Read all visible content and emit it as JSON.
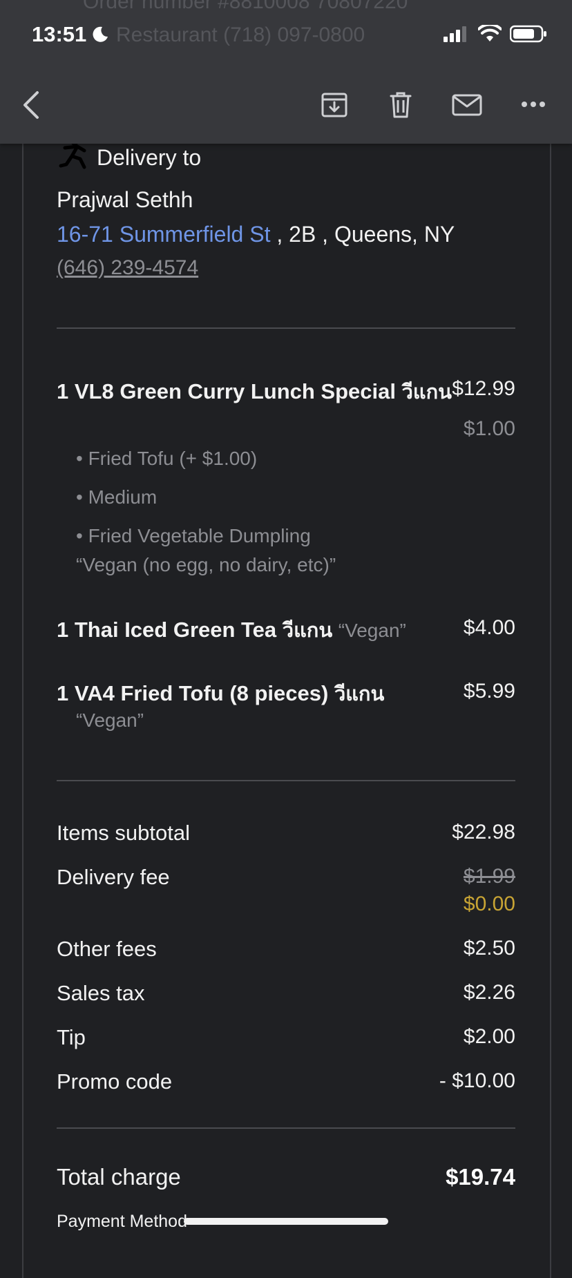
{
  "status_bar": {
    "time": "13:51"
  },
  "ghost_header": {
    "line1": "Order number #8810008 70807220",
    "line2": "Restaurant (718) 097-0800"
  },
  "delivery": {
    "title": "Delivery to",
    "name": "Prajwal Sethh",
    "street": "16-71 Summerfield St",
    "address_rest": " , 2B , Queens, NY",
    "phone": "(646) 239-4574"
  },
  "items": [
    {
      "title": "1 VL8 Green Curry Lunch Special",
      "thai": "วีแกน",
      "price": "$12.99",
      "extra_price": "$1.00",
      "options": [
        "• Fried Tofu (+ $1.00)",
        "• Medium",
        "• Fried Vegetable Dumpling"
      ],
      "note": "“Vegan (no egg, no dairy, etc)”"
    },
    {
      "title": "1 Thai Iced Green Tea",
      "thai": "วีแกน",
      "note": "“Vegan”",
      "price": "$4.00"
    },
    {
      "title": "1 VA4 Fried Tofu (8 pieces)",
      "thai": "วีแกน",
      "note": "“Vegan”",
      "price": "$5.99"
    }
  ],
  "summary": {
    "subtotal_label": "Items subtotal",
    "subtotal": "$22.98",
    "delivery_label": "Delivery fee",
    "delivery_old": "$1.99",
    "delivery_new": "$0.00",
    "other_label": "Other fees",
    "other": "$2.50",
    "tax_label": "Sales tax",
    "tax": "$2.26",
    "tip_label": "Tip",
    "tip": "$2.00",
    "promo_label": "Promo code",
    "promo": "- $10.00",
    "total_label": "Total charge",
    "total": "$19.74",
    "payment_label": "Payment Method"
  },
  "colors": {
    "link": "#6f95e6",
    "discount": "#c8a434",
    "background": "#1f2023",
    "toolbar": "#37383c"
  }
}
